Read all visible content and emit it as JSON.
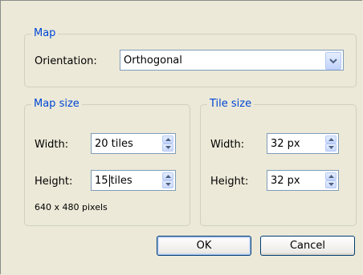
{
  "map_group": {
    "legend": "Map",
    "orientation_label": "Orientation:",
    "orientation_value": "Orthogonal",
    "orientation_button_icon": "chevron-down-icon"
  },
  "map_size_group": {
    "legend": "Map size",
    "width_label": "Width:",
    "width_value": "20 tiles",
    "height_label": "Height:",
    "height_value_before_caret": "15",
    "height_value_after_caret": "tiles",
    "pixels_text": "640 x 480 pixels"
  },
  "tile_size_group": {
    "legend": "Tile size",
    "width_label": "Width:",
    "width_value": "32 px",
    "height_label": "Height:",
    "height_value": "32 px"
  },
  "buttons": {
    "ok": "OK",
    "cancel": "Cancel"
  },
  "colors": {
    "legend": "#0046d5",
    "dialog_background": "#ece9d8",
    "field_border": "#7f9db9"
  }
}
